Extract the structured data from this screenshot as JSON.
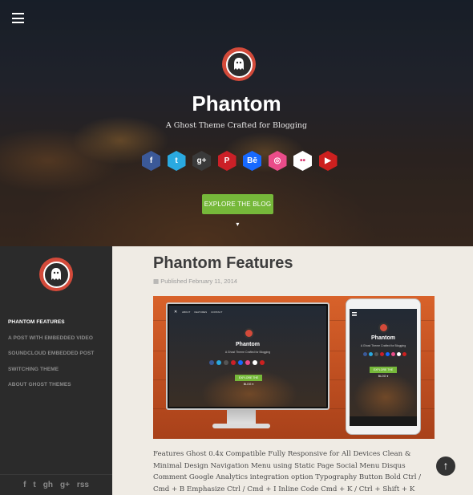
{
  "header": {
    "title": "Phantom",
    "subtitle": "A Ghost Theme Crafted for Blogging",
    "explore_label": "EXPLORE THE BLOG ▾",
    "social": [
      {
        "name": "facebook-icon",
        "glyph": "f",
        "color": "#3b5998"
      },
      {
        "name": "twitter-icon",
        "glyph": "t",
        "color": "#2aa9e0"
      },
      {
        "name": "google-plus-icon",
        "glyph": "g+",
        "color": "#3a3a3a"
      },
      {
        "name": "pinterest-icon",
        "glyph": "P",
        "color": "#cb2027"
      },
      {
        "name": "behance-icon",
        "glyph": "Bē",
        "color": "#1769ff"
      },
      {
        "name": "dribbble-icon",
        "glyph": "◎",
        "color": "#ea4c89"
      },
      {
        "name": "flickr-icon",
        "glyph": "••",
        "color": "#ffffff"
      },
      {
        "name": "youtube-icon",
        "glyph": "▶",
        "color": "#cd201f"
      }
    ]
  },
  "sidebar": {
    "items": [
      {
        "label": "PHANTOM FEATURES"
      },
      {
        "label": "A POST WITH EMBEDDED VIDEO"
      },
      {
        "label": "SOUNDCLOUD EMBEDDED POST"
      },
      {
        "label": "SWITCHING THEME"
      },
      {
        "label": "ABOUT GHOST THEMES"
      }
    ],
    "social": [
      "f",
      "t",
      "gh",
      "g+",
      "rss"
    ]
  },
  "post": {
    "title": "Phantom Features",
    "date": "Published February 11, 2014",
    "body": "Features Ghost 0.4x Compatible Fully Responsive for All Devices Clean & Minimal Design Navigation Menu using Static Page Social Menu Disqus Comment Google Analytics integration option Typography Button Bold Ctrl / Cmd + B Emphasize Ctrl / Cmd + I Inline Code Cmd + K / Ctrl + Shift + K Strike-through Ctrl + Alt + U"
  },
  "mockup": {
    "title": "Phantom",
    "subtitle": "A Ghost Theme Crafted for Blogging",
    "button": "EXPLORE THE BLOG ▾",
    "nav": [
      "ABOUT",
      "FEATURES",
      "CONTACT"
    ]
  },
  "colors": {
    "accent_green": "#76b83a",
    "logo_red": "#d34a3a",
    "sidebar_bg": "#2b2b2b",
    "content_bg": "#efebe4"
  }
}
